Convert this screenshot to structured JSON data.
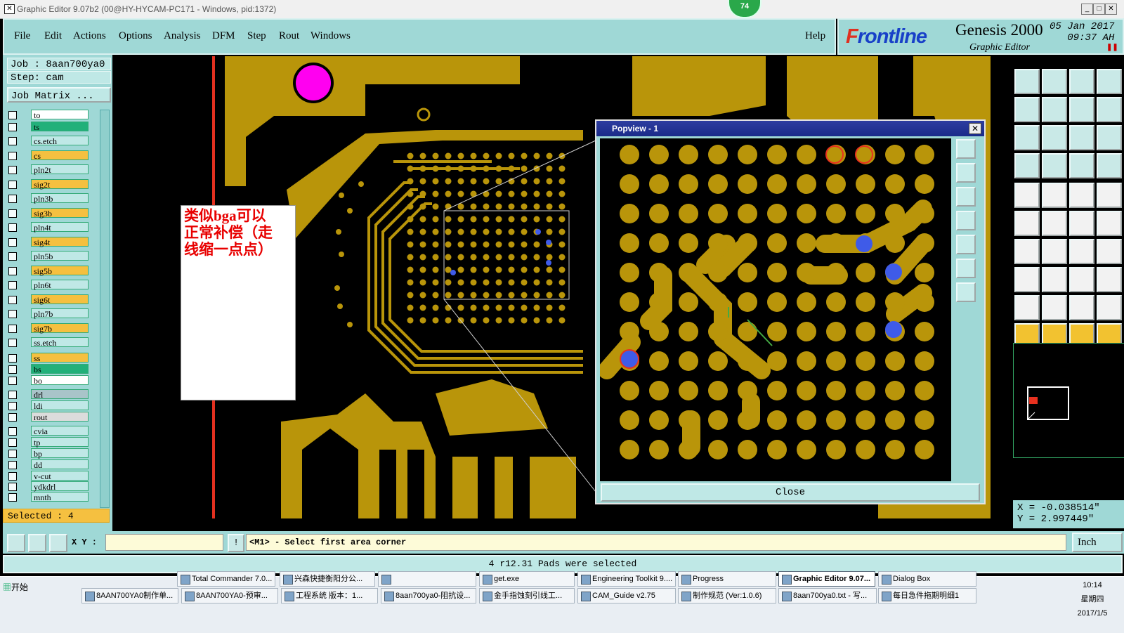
{
  "window": {
    "title": "Graphic Editor 9.07b2 (00@HY-HYCAM-PC171 - Windows, pid:1372)",
    "badge": "74"
  },
  "menu": {
    "items": [
      "File",
      "Edit",
      "Actions",
      "Options",
      "Analysis",
      "DFM",
      "Step",
      "Rout",
      "Windows"
    ],
    "help": "Help"
  },
  "brand": {
    "logo_mark": "F",
    "logo_rest": "rontline",
    "product": "Genesis 2000",
    "subtitle": "Graphic Editor",
    "date": "05 Jan 2017",
    "time": "09:37 AH"
  },
  "job": {
    "job_line": "Job : 8aan700ya0",
    "step_line": "Step: cam",
    "matrix_button": "Job Matrix ..."
  },
  "layers": [
    {
      "name": "to",
      "color": "#ffffff"
    },
    {
      "name": "ts",
      "color": "#22b07a"
    },
    {
      "name": "cs.etch",
      "color": "#bfe8e6"
    },
    {
      "name": "cs",
      "color": "#f5c040"
    },
    {
      "name": "pln2t",
      "color": "#bfe8e6"
    },
    {
      "name": "sig2t",
      "color": "#f5c040"
    },
    {
      "name": "pln3b",
      "color": "#bfe8e6"
    },
    {
      "name": "sig3b",
      "color": "#f5c040"
    },
    {
      "name": "pln4t",
      "color": "#bfe8e6"
    },
    {
      "name": "sig4t",
      "color": "#f5c040"
    },
    {
      "name": "pln5b",
      "color": "#bfe8e6"
    },
    {
      "name": "sig5b",
      "color": "#f5c040"
    },
    {
      "name": "pln6t",
      "color": "#bfe8e6"
    },
    {
      "name": "sig6t",
      "color": "#f5c040"
    },
    {
      "name": "pln7b",
      "color": "#bfe8e6"
    },
    {
      "name": "sig7b",
      "color": "#f5c040"
    },
    {
      "name": "ss.etch",
      "color": "#bfe8e6"
    },
    {
      "name": "ss",
      "color": "#f5c040"
    },
    {
      "name": "bs",
      "color": "#22b07a"
    },
    {
      "name": "bo",
      "color": "#ffffff"
    },
    {
      "name": "drl",
      "color": "#a9c4c9"
    },
    {
      "name": "ldi",
      "color": "#bfe8e6"
    },
    {
      "name": "rout",
      "color": "#dcdcdc"
    },
    {
      "name": "cvia",
      "color": "#bfe8e6"
    },
    {
      "name": "tp",
      "color": "#bfe8e6"
    },
    {
      "name": "bp",
      "color": "#bfe8e6"
    },
    {
      "name": "dd",
      "color": "#bfe8e6"
    },
    {
      "name": "v-cut",
      "color": "#bfe8e6"
    },
    {
      "name": "ydkdrl",
      "color": "#bfe8e6"
    },
    {
      "name": "mnth",
      "color": "#bfe8e6"
    }
  ],
  "selected_label": "Selected : 4",
  "annotation": {
    "line1": "类似bga可以",
    "line2": "正常补偿（走",
    "line3": "线缩一点点）"
  },
  "popview": {
    "title": "Popview - 1",
    "close_label": "Close",
    "close_x": "✕"
  },
  "coords": {
    "x": "X = -0.038514\"",
    "y": "Y = 2.997449\""
  },
  "command": {
    "xy_label": "X Y :",
    "prompt": "<M1> - Select first area corner",
    "unit": "Inch"
  },
  "status": "4 r12.31 Pads were selected",
  "taskbar": {
    "start": "开始",
    "row1": [
      "Total Commander 7.0...",
      "兴森快捷衡阳分公...",
      "",
      "get.exe",
      "Engineering Toolkit 9....",
      "Progress",
      "Graphic Editor 9.07...",
      "Dialog Box"
    ],
    "row2": [
      "8AAN700YA0制作单...",
      "8AAN700YA0-预审...",
      "工程系统 版本：1...",
      "8aan700ya0-阻抗设...",
      "金手指蚀刻引线工...",
      "CAM_Guide v2.75",
      "制作规范 (Ver:1.0.6)",
      "8aan700ya0.txt - 写...",
      "每日急件拖期明细1"
    ],
    "clock": "10:14",
    "weekday": "星期四",
    "date": "2017/1/5"
  },
  "colors": {
    "copper": "#b9950a",
    "panel": "#9fd8d6",
    "highlight_pad": "#3f5be8",
    "selected_red": "#e8311f"
  }
}
